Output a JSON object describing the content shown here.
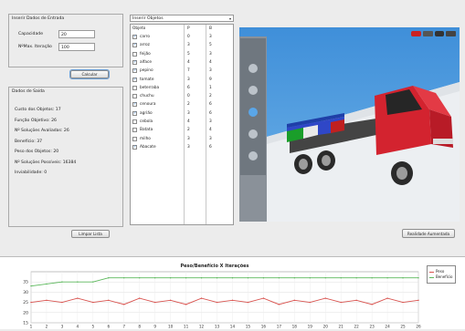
{
  "entrada": {
    "title": "Inserir Dados de Entrada",
    "capacidade_label": "Capacidade",
    "capacidade_value": "20",
    "iteracao_label": "NºMax. Iteração",
    "iteracao_value": "100",
    "calc_button": "Calcular"
  },
  "saida": {
    "title": "Dados de Saída",
    "lines": [
      "Custo dos Objetos: 17",
      "Função Objetivo:   26",
      "Nº Soluções Avaliadas: 26",
      "Benefício: 37",
      "Peso dos Objetos: 20",
      "Nº Soluções Possíveis: 16384",
      "Inviabilidade: 0"
    ],
    "clear_button": "Limpar Lista"
  },
  "objetos": {
    "dropdown_label": "Inserir Objetos",
    "headers": [
      "Objeto",
      "P",
      "B"
    ],
    "rows": [
      {
        "name": "carro",
        "p": "0",
        "b": "3",
        "checked": true
      },
      {
        "name": "arroz",
        "p": "3",
        "b": "5",
        "checked": true
      },
      {
        "name": "feijão",
        "p": "5",
        "b": "3",
        "checked": false
      },
      {
        "name": "alface",
        "p": "4",
        "b": "4",
        "checked": true
      },
      {
        "name": "pepino",
        "p": "7",
        "b": "3",
        "checked": true
      },
      {
        "name": "tomate",
        "p": "3",
        "b": "9",
        "checked": true
      },
      {
        "name": "beterraba",
        "p": "6",
        "b": "1",
        "checked": false
      },
      {
        "name": "chuchu",
        "p": "0",
        "b": "2",
        "checked": false
      },
      {
        "name": "cenoura",
        "p": "2",
        "b": "6",
        "checked": true
      },
      {
        "name": "agrião",
        "p": "3",
        "b": "6",
        "checked": true
      },
      {
        "name": "cebola",
        "p": "4",
        "b": "3",
        "checked": false
      },
      {
        "name": "Batata",
        "p": "2",
        "b": "4",
        "checked": false
      },
      {
        "name": "milho",
        "p": "3",
        "b": "3",
        "checked": false
      },
      {
        "name": "Abacate",
        "p": "3",
        "b": "6",
        "checked": true
      }
    ]
  },
  "view3d": {
    "ar_button": "Realidade Aumentada",
    "toolbar_icons": [
      "car-icon",
      "bus-icon",
      "car-small-icon",
      "truck-icon"
    ],
    "side_tools": [
      "pan-icon",
      "rotate-icon",
      "zoom-icon",
      "select-icon",
      "fit-icon"
    ]
  },
  "chart_data": {
    "type": "line",
    "title": "Peso/Benefício X Iterações",
    "xlabel": "",
    "ylabel": "",
    "x": [
      1,
      2,
      3,
      4,
      5,
      6,
      7,
      8,
      9,
      10,
      11,
      12,
      13,
      14,
      15,
      16,
      17,
      18,
      19,
      20,
      21,
      22,
      23,
      24,
      25,
      26
    ],
    "ylim": [
      15,
      40
    ],
    "yticks": [
      15,
      20,
      25,
      30,
      35
    ],
    "series": [
      {
        "name": "Peso",
        "color": "#d9534f",
        "values": [
          25,
          26,
          25,
          27,
          25,
          26,
          24,
          27,
          25,
          26,
          24,
          27,
          25,
          26,
          25,
          27,
          24,
          26,
          25,
          27,
          25,
          26,
          24,
          27,
          25,
          26
        ]
      },
      {
        "name": "Benefício",
        "color": "#5cb85c",
        "values": [
          33,
          34,
          35,
          35,
          35,
          37,
          37,
          37,
          37,
          37,
          37,
          37,
          37,
          37,
          37,
          37,
          37,
          37,
          37,
          37,
          37,
          37,
          37,
          37,
          37,
          37
        ]
      }
    ],
    "grid": true,
    "legend": "right"
  }
}
